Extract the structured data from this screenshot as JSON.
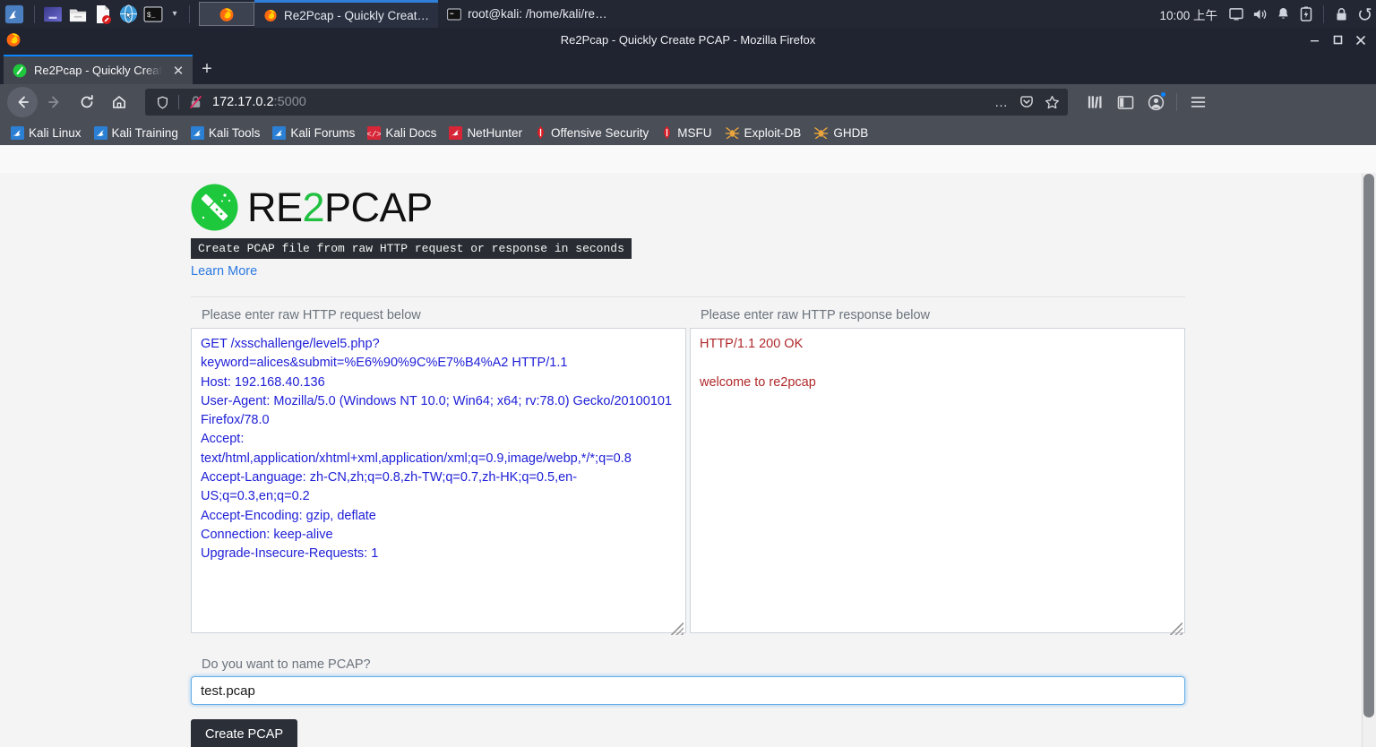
{
  "taskbar": {
    "launcher_icon": "kali-dragon-icon",
    "quick_launch": [
      {
        "name": "app-menu-icon",
        "label": "Applications"
      },
      {
        "name": "file-manager-icon",
        "label": "File Manager"
      },
      {
        "name": "text-editor-icon",
        "label": "Text Editor"
      },
      {
        "name": "web-browser-icon",
        "label": "Web Browser"
      },
      {
        "name": "terminal-icon",
        "label": "Terminal"
      }
    ],
    "window_buttons": [
      {
        "name": "firefox-window-button",
        "icon": "firefox-icon",
        "label": "",
        "active": true
      }
    ],
    "tasks": [
      {
        "icon": "firefox-icon",
        "label": "Re2Pcap - Quickly Creat…",
        "active": true
      },
      {
        "icon": "terminal-icon",
        "label": "root@kali: /home/kali/re…",
        "active": false
      }
    ],
    "clock": "10:00 上午",
    "tray": [
      {
        "name": "display-icon"
      },
      {
        "name": "volume-icon"
      },
      {
        "name": "notifications-bell-icon"
      },
      {
        "name": "battery-icon"
      },
      {
        "name": "lock-icon"
      },
      {
        "name": "logout-icon"
      }
    ]
  },
  "browser": {
    "window_title": "Re2Pcap - Quickly Create PCAP - Mozilla Firefox",
    "window_controls": {
      "minimize": "—",
      "maximize": "◻",
      "close": "✕"
    },
    "tabs": [
      {
        "title": "Re2Pcap - Quickly Create",
        "favicon": "re2pcap-favicon",
        "close_label": "✕"
      }
    ],
    "new_tab_label": "+",
    "nav": {
      "back": "back-arrow-icon",
      "forward": "forward-arrow-icon",
      "reload": "reload-icon",
      "home": "home-icon"
    },
    "urlbar": {
      "shield_icon": "tracking-protection-shield-icon",
      "connection_icon": "insecure-connection-icon",
      "host": "172.17.0.2",
      "port": ":5000",
      "page_actions_label": "…",
      "pocket_icon": "pocket-icon",
      "bookmark_star_icon": "star-icon"
    },
    "toolbar_right": [
      {
        "name": "library-icon"
      },
      {
        "name": "sidebar-icon"
      },
      {
        "name": "account-icon"
      },
      {
        "name": "menu-hamburger-icon"
      }
    ],
    "bookmarks": [
      {
        "label": "Kali Linux",
        "icon": "kali-bookmark-icon"
      },
      {
        "label": "Kali Training",
        "icon": "kali-bookmark-icon"
      },
      {
        "label": "Kali Tools",
        "icon": "kali-bookmark-icon"
      },
      {
        "label": "Kali Forums",
        "icon": "kali-bookmark-icon"
      },
      {
        "label": "Kali Docs",
        "icon": "kali-docs-icon"
      },
      {
        "label": "NetHunter",
        "icon": "nethunter-icon"
      },
      {
        "label": "Offensive Security",
        "icon": "offsec-icon"
      },
      {
        "label": "MSFU",
        "icon": "offsec-icon"
      },
      {
        "label": "Exploit-DB",
        "icon": "exploitdb-icon"
      },
      {
        "label": "GHDB",
        "icon": "exploitdb-icon"
      }
    ]
  },
  "page": {
    "logo": {
      "text_before": "RE",
      "accent": "2",
      "text_after": "PCAP",
      "mark": "re2pcap-wand-logo"
    },
    "tagline": "Create PCAP file from raw HTTP request or response in seconds",
    "learn_more": "Learn More",
    "request": {
      "label": "Please enter raw HTTP request below",
      "value": "GET /xsschallenge/level5.php?keyword=alices&submit=%E6%90%9C%E7%B4%A2 HTTP/1.1\nHost: 192.168.40.136\nUser-Agent: Mozilla/5.0 (Windows NT 10.0; Win64; x64; rv:78.0) Gecko/20100101 Firefox/78.0\nAccept: text/html,application/xhtml+xml,application/xml;q=0.9,image/webp,*/*;q=0.8\nAccept-Language: zh-CN,zh;q=0.8,zh-TW;q=0.7,zh-HK;q=0.5,en-US;q=0.3,en;q=0.2\nAccept-Encoding: gzip, deflate\nConnection: keep-alive\nUpgrade-Insecure-Requests: 1"
    },
    "response": {
      "label": "Please enter raw HTTP response below",
      "value": "HTTP/1.1 200 OK\n\nwelcome to re2pcap"
    },
    "pcap_name": {
      "label": "Do you want to name PCAP?",
      "value": "test.pcap",
      "placeholder": ""
    },
    "create_button": "Create PCAP",
    "colors": {
      "brand_green": "#20c040",
      "request_text": "#2020d8",
      "response_text": "#b0282a",
      "link": "#2a7ae2",
      "button_bg": "#2b3038",
      "focus_ring": "#66afe9"
    }
  }
}
